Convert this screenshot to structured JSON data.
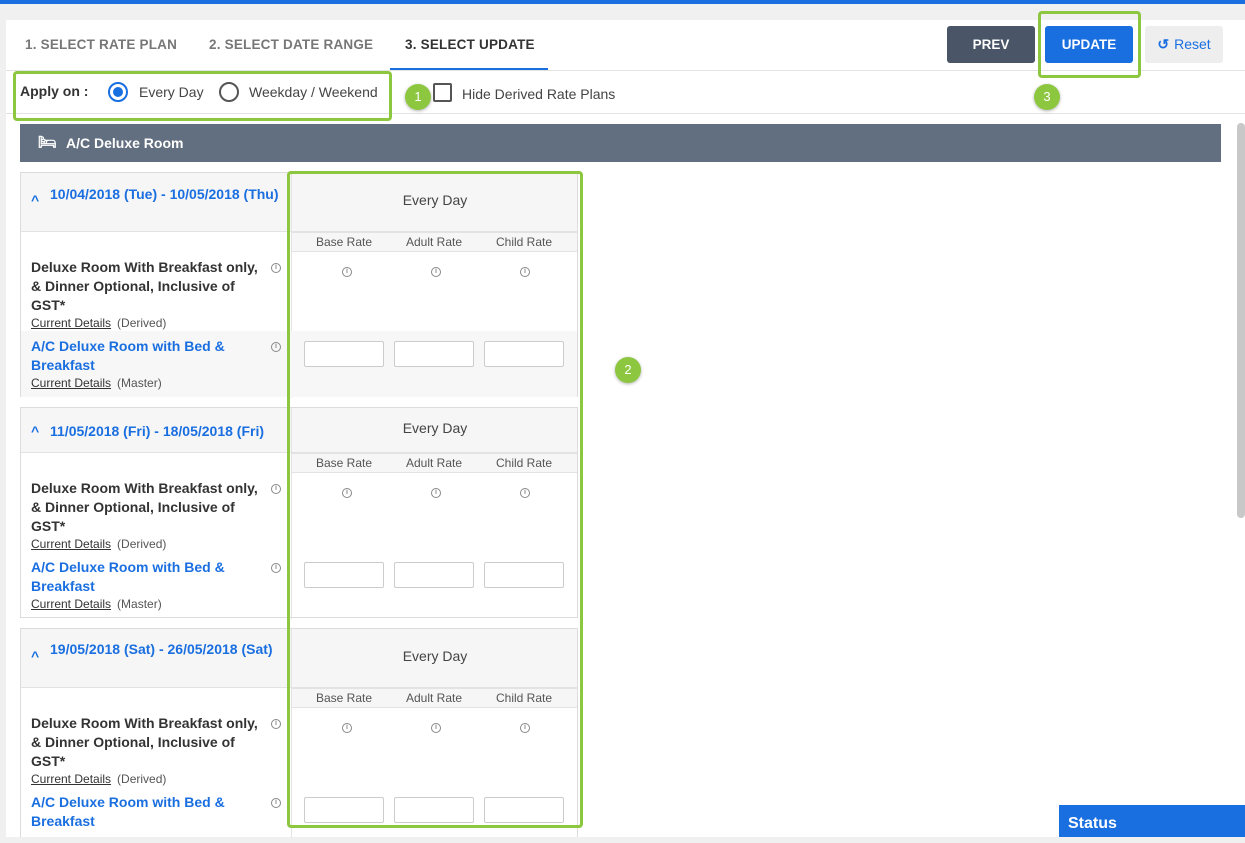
{
  "tabs": [
    "1. SELECT RATE PLAN",
    "2. SELECT DATE RANGE",
    "3. SELECT UPDATE"
  ],
  "buttons": {
    "prev": "PREV",
    "update": "UPDATE",
    "reset": "Reset"
  },
  "apply": {
    "label": "Apply on :",
    "options": [
      "Every Day",
      "Weekday / Weekend"
    ],
    "selected": "Every Day"
  },
  "hide_derived": {
    "label": "Hide Derived Rate Plans",
    "checked": false
  },
  "room": {
    "name": "A/C Deluxe Room"
  },
  "columns": [
    "Base Rate",
    "Adult Rate",
    "Child Rate"
  ],
  "blocks": [
    {
      "date_range": "10/04/2018 (Tue)  -  10/05/2018 (Thu)",
      "header": "Every Day",
      "derived": {
        "name": "Deluxe Room With Breakfast only, & Dinner Optional, Inclusive of GST*",
        "details": "Current Details",
        "tag": "(Derived)"
      },
      "master": {
        "name": "A/C Deluxe Room with Bed & Breakfast",
        "details": "Current Details",
        "tag": "(Master)"
      }
    },
    {
      "date_range": "11/05/2018 (Fri)  -  18/05/2018 (Fri)",
      "header": "Every Day",
      "derived": {
        "name": "Deluxe Room With Breakfast only, & Dinner Optional, Inclusive of GST*",
        "details": "Current Details",
        "tag": "(Derived)"
      },
      "master": {
        "name": "A/C Deluxe Room with Bed & Breakfast",
        "details": "Current Details",
        "tag": "(Master)"
      }
    },
    {
      "date_range": "19/05/2018 (Sat)  -  26/05/2018 (Sat)",
      "header": "Every Day",
      "derived": {
        "name": "Deluxe Room With Breakfast only, & Dinner Optional, Inclusive of GST*",
        "details": "Current Details",
        "tag": "(Derived)"
      },
      "master": {
        "name": "A/C Deluxe Room with Bed & Breakfast",
        "details": "",
        "tag": ""
      }
    }
  ],
  "annotations": [
    "1",
    "2",
    "3"
  ],
  "status": {
    "label": "Status"
  },
  "icons": {
    "bed": "bed-icon",
    "reset": "refresh-icon",
    "chevron": "chevron-up-icon",
    "info": "info-icon"
  },
  "colors": {
    "accent": "#1a6fe0",
    "highlight": "#8dc63f",
    "header": "#626f80"
  }
}
